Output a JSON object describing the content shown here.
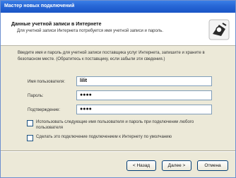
{
  "window": {
    "title": "Мастер новых подключений"
  },
  "header": {
    "title": "Данные учетной записи в Интернете",
    "subtitle": "Для учетной записи Интернета потребуется имя учетной записи и пароль."
  },
  "intro": {
    "text": "Введите имя и пароль для учетной записи поставщика услуг Интернета, запишите и храните в безопасном месте. (Обратитесь к поставщику, если забыли эти сведения.)"
  },
  "form": {
    "username": {
      "label": "Имя пользователя:",
      "value": "lilit"
    },
    "password": {
      "label": "Пароль:",
      "value": "●●●●"
    },
    "confirm": {
      "label": "Подтверждение:",
      "value": "●●●●"
    }
  },
  "options": [
    {
      "label": "Использовать следующие имя пользователя и пароль при подключении любого пользователя"
    },
    {
      "label": "Сделать это подключение подключением к Интернету по умолчанию"
    }
  ],
  "buttons": {
    "back": "< Назад",
    "next": "Далее >",
    "cancel": "Отмена"
  },
  "colors": {
    "titlebar": "#2766d6",
    "dialog": "#ece9d8",
    "header_bg": "#ffffff"
  },
  "icons": [
    "wizard-connection-icon",
    "checkbox"
  ]
}
